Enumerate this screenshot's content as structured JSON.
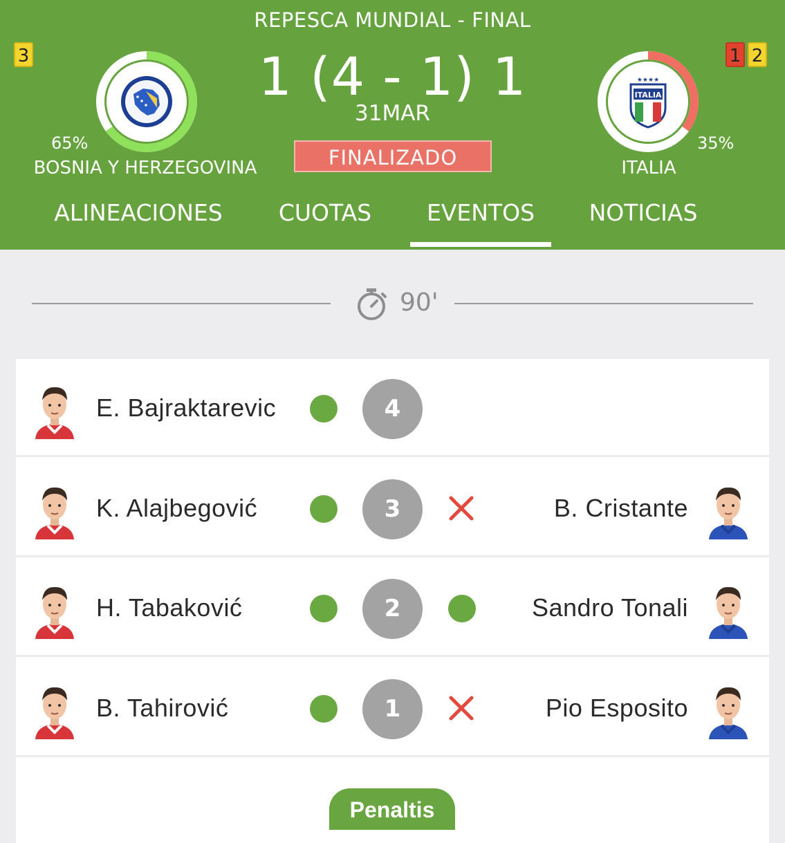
{
  "match": {
    "competition": "REPESCA MUNDIAL - FINAL",
    "score": "1 (4 - 1) 1",
    "date": "31MAR",
    "status": "FINALIZADO"
  },
  "home": {
    "name": "BOSNIA Y HERZEGOVINA",
    "percent": "65%",
    "percent_value": 65,
    "yellow_cards": "3"
  },
  "away": {
    "name": "ITALIA",
    "percent": "35%",
    "percent_value": 35,
    "red_cards": "1",
    "yellow_cards": "2",
    "crest_text": "ITALIA"
  },
  "tabs": [
    {
      "label": "ALINEACIONES"
    },
    {
      "label": "CUOTAS"
    },
    {
      "label": "EVENTOS",
      "active": true
    },
    {
      "label": "NOTICIAS"
    }
  ],
  "timeline": {
    "minute": "90'"
  },
  "penalties": [
    {
      "number": "4",
      "home_player": "E. Bajraktarevic",
      "home_result": "goal",
      "away_player": "",
      "away_result": ""
    },
    {
      "number": "3",
      "home_player": "K. Alajbegović",
      "home_result": "goal",
      "away_player": "B. Cristante",
      "away_result": "miss"
    },
    {
      "number": "2",
      "home_player": "H. Tabaković",
      "home_result": "goal",
      "away_player": "Sandro Tonali",
      "away_result": "goal"
    },
    {
      "number": "1",
      "home_player": "B. Tahirović",
      "home_result": "goal",
      "away_player": "Pio Esposito",
      "away_result": "miss"
    }
  ],
  "penalties_button": "Penaltis",
  "colors": {
    "header_green": "#66a33f",
    "goal_green": "#6aa842",
    "miss_red": "#e24a3d",
    "status_red": "#ea7166",
    "home_ring": "#8fe05a",
    "away_ring": "#ef6f62"
  }
}
